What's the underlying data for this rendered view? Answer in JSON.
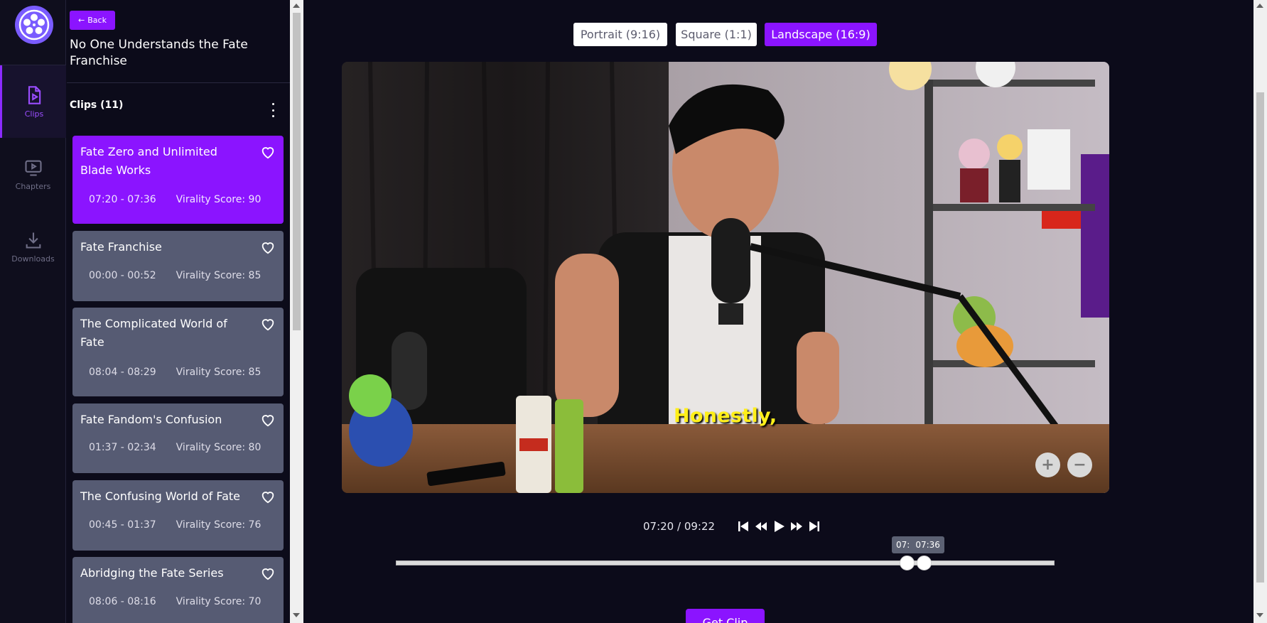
{
  "rail": {
    "items": [
      {
        "label": "Clips",
        "active": true
      },
      {
        "label": "Chapters",
        "active": false
      },
      {
        "label": "Downloads",
        "active": false
      }
    ]
  },
  "sidebar": {
    "back_label": "Back",
    "video_title": "No One Understands the Fate Franchise",
    "clips_heading": "Clips (11)",
    "clips": [
      {
        "title": "Fate Zero and Unlimited Blade Works",
        "range": "07:20 - 07:36",
        "score": "Virality Score: 90",
        "active": true
      },
      {
        "title": "Fate Franchise",
        "range": "00:00 - 00:52",
        "score": "Virality Score: 85",
        "active": false
      },
      {
        "title": "The Complicated World of Fate",
        "range": "08:04 - 08:29",
        "score": "Virality Score: 85",
        "active": false
      },
      {
        "title": "Fate Fandom's Confusion",
        "range": "01:37 - 02:34",
        "score": "Virality Score: 80",
        "active": false
      },
      {
        "title": "The Confusing World of Fate",
        "range": "00:45 - 01:37",
        "score": "Virality Score: 76",
        "active": false
      },
      {
        "title": "Abridging the Fate Series",
        "range": "08:06 - 08:16",
        "score": "Virality Score: 70",
        "active": false
      }
    ]
  },
  "aspect": {
    "options": [
      {
        "label": "Portrait (9:16)",
        "active": false
      },
      {
        "label": "Square (1:1)",
        "active": false
      },
      {
        "label": "Landscape (16:9)",
        "active": true
      }
    ]
  },
  "player": {
    "caption": "Honestly,",
    "zoom_in": "+",
    "zoom_out": "−",
    "time": "07:20 / 09:22"
  },
  "range": {
    "tooltip_start": "07:",
    "tooltip_end": "07:36",
    "start_fraction": 0.776,
    "end_fraction": 0.802
  },
  "actions": {
    "get_clip": "Get Clip"
  },
  "colors": {
    "accent": "#8b14ff",
    "clip_card": "#565b73",
    "background": "#0c0b1a",
    "caption": "#ffef1a"
  }
}
